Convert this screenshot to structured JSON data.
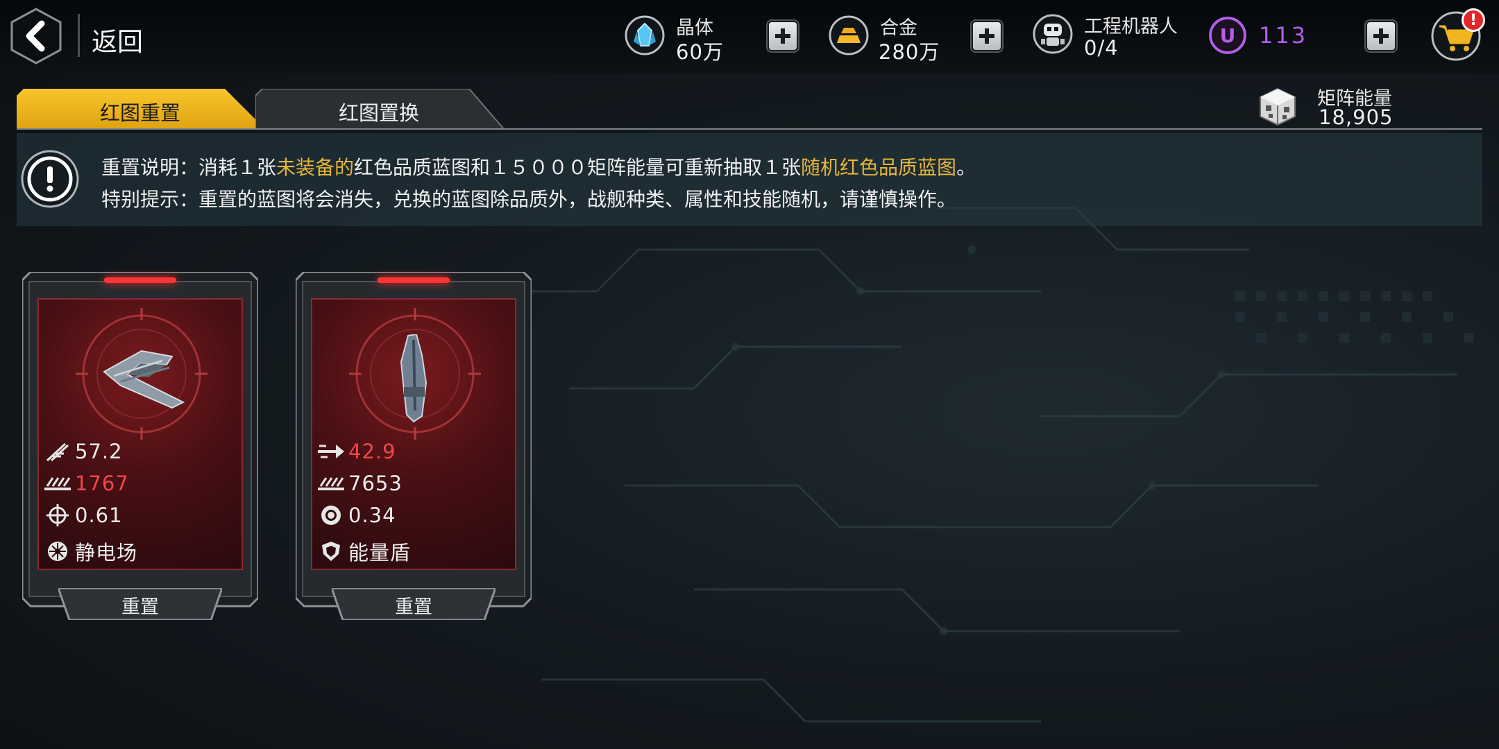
{
  "header": {
    "back_label": "返回",
    "resources": [
      {
        "name": "晶体",
        "value": "60万",
        "icon": "crystal-icon"
      },
      {
        "name": "合金",
        "value": "280万",
        "icon": "alloy-icon"
      },
      {
        "name": "工程机器人",
        "value": "0/4",
        "icon": "robot-icon"
      }
    ],
    "u_currency": {
      "icon_letter": "U",
      "value": "113"
    },
    "cart": {
      "badge": "!"
    }
  },
  "tabs": [
    {
      "label": "红图重置",
      "active": true
    },
    {
      "label": "红图置换",
      "active": false
    }
  ],
  "matrix_energy": {
    "label": "矩阵能量",
    "value": "18,905"
  },
  "notice": {
    "line1_prefix": "重置说明：消耗１张",
    "line1_hl1": "未装备的",
    "line1_mid": "红色品质蓝图和１５０００矩阵能量可重新抽取１张",
    "line1_hl2": "随机红色品质蓝图",
    "line1_suffix": "。",
    "line2": "特别提示：重置的蓝图将会消失，兑换的蓝图除品质外，战舰种类、属性和技能随机，请谨慎操作。"
  },
  "cards": [
    {
      "stats": [
        {
          "icon": "missile-icon",
          "value": "57.2",
          "highlight": false
        },
        {
          "icon": "firepower-icon",
          "value": "1767",
          "highlight": true
        },
        {
          "icon": "crosshair-icon",
          "value": "0.61",
          "highlight": false
        },
        {
          "icon": "static-field-icon",
          "value": "静电场",
          "highlight": false
        }
      ],
      "button": "重置"
    },
    {
      "stats": [
        {
          "icon": "speed-arrow-icon",
          "value": "42.9",
          "highlight": true
        },
        {
          "icon": "firepower-icon",
          "value": "7653",
          "highlight": false
        },
        {
          "icon": "gear-icon",
          "value": "0.34",
          "highlight": false
        },
        {
          "icon": "shield-icon",
          "value": "能量盾",
          "highlight": false
        }
      ],
      "button": "重置"
    }
  ],
  "colors": {
    "accent": "#f2b51e",
    "highlight_text": "#e6b63a",
    "red_stat": "#f0464a",
    "u_purple": "#b35ee9"
  }
}
